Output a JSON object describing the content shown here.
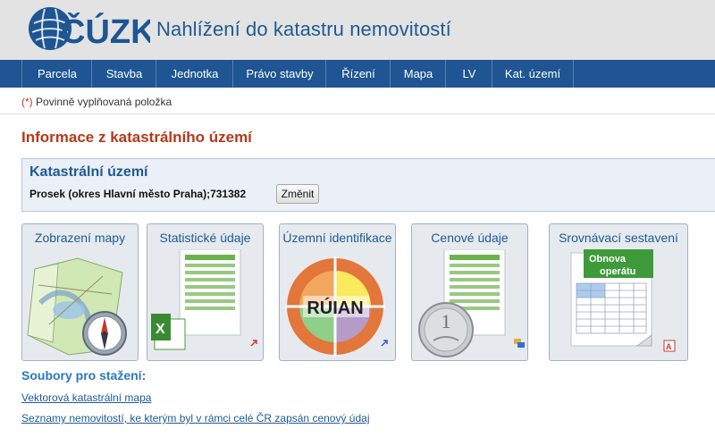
{
  "header": {
    "logo_text": "ČÚZK",
    "title": "Nahlížení do katastru nemovitostí"
  },
  "nav": {
    "items": [
      "Parcela",
      "Stavba",
      "Jednotka",
      "Právo stavby",
      "Řízení",
      "Mapa",
      "LV",
      "Kat. území"
    ]
  },
  "required_note": {
    "mark": "(*)",
    "text": "Povinně vyplňovaná položka"
  },
  "page_title": "Informace z katastrálního území",
  "cadastral_area": {
    "heading": "Katastrální území",
    "value": "Prosek (okres Hlavní město Praha);731382",
    "change_button": "Změnit"
  },
  "tiles": [
    {
      "label": "Zobrazení mapy",
      "icon": "map-compass-icon"
    },
    {
      "label": "Statistické údaje",
      "icon": "spreadsheet-icon"
    },
    {
      "label": "Územní identifikace",
      "icon": "ruian-icon",
      "image_text": "RÚIAN"
    },
    {
      "label": "Cenové údaje",
      "icon": "price-coin-icon"
    },
    {
      "label": "Srovnávací sestavení",
      "icon": "renewal-sheet-icon",
      "image_text_1": "Obnova",
      "image_text_2": "operátu"
    }
  ],
  "downloads": {
    "heading": "Soubory pro stažení:",
    "links": [
      "Vektorová katastrální mapa",
      "Seznamy nemovitostí, ke kterým byl v rámci celé ČR zapsán cenový údaj"
    ]
  },
  "colors": {
    "header_bg": "#e3e3e3",
    "nav_bg": "#1e5592",
    "title_red": "#b5381a",
    "link_blue": "#1f5a94"
  }
}
